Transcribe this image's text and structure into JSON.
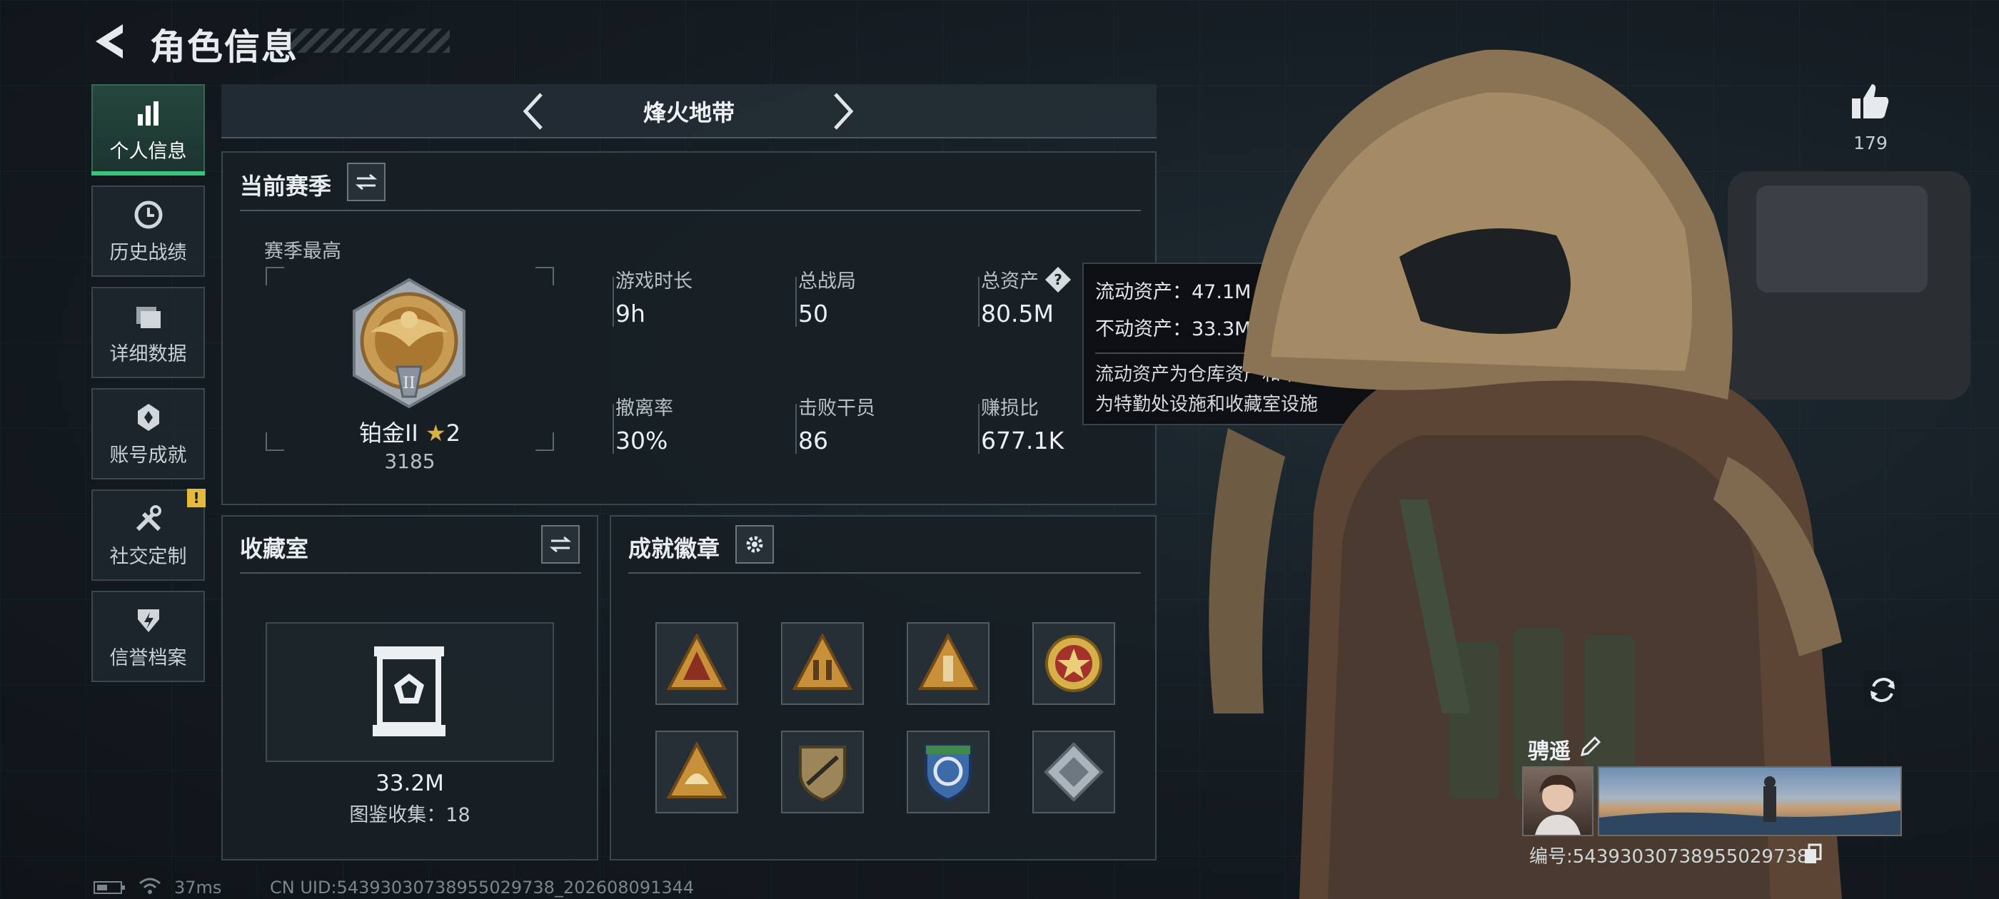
{
  "header": {
    "title": "角色信息"
  },
  "sidebar": {
    "items": [
      {
        "label": "个人信息",
        "icon": "bar-chart-icon",
        "active": true
      },
      {
        "label": "历史战绩",
        "icon": "history-clock-icon"
      },
      {
        "label": "详细数据",
        "icon": "folder-icon"
      },
      {
        "label": "账号成就",
        "icon": "achievement-icon"
      },
      {
        "label": "社交定制",
        "icon": "tools-icon",
        "badge": "!"
      },
      {
        "label": "信誉档案",
        "icon": "credit-shield-icon"
      }
    ]
  },
  "mode": {
    "title": "烽火地带"
  },
  "season": {
    "title": "当前赛季",
    "best_label": "赛季最高",
    "rank_name": "铂金II",
    "rank_stars": "2",
    "rank_score": "3185",
    "stats": [
      {
        "label": "游戏时长",
        "value": "9h"
      },
      {
        "label": "总战局",
        "value": "50"
      },
      {
        "label": "总资产",
        "value": "80.5M"
      },
      {
        "label": "撤离率",
        "value": "30%"
      },
      {
        "label": "击败干员",
        "value": "86"
      },
      {
        "label": "赚损比",
        "value": "677.1K"
      }
    ]
  },
  "tooltip": {
    "liquid": "流动资产：47.1M",
    "fixed": "不动资产：33.3M",
    "desc_line1": "流动资产为仓库资产和哈夫币，不动资产",
    "desc_line2": "为特勤处设施和收藏室设施"
  },
  "collection": {
    "title": "收藏室",
    "value": "33.2M",
    "catalog": "图鉴收集：18"
  },
  "badges": {
    "title": "成就徽章",
    "items": [
      {
        "icon": "triangle-badge-red-icon",
        "color": "#c9903a"
      },
      {
        "icon": "triangle-badge-soldiers-icon",
        "color": "#c9903a"
      },
      {
        "icon": "triangle-badge-tower-icon",
        "color": "#c9903a"
      },
      {
        "icon": "star-medal-icon",
        "color": "#d8b04a"
      },
      {
        "icon": "triangle-badge-helmet-icon",
        "color": "#c9903a"
      },
      {
        "icon": "shield-rifle-badge-icon",
        "color": "#9c8558"
      },
      {
        "icon": "blue-shield-badge-icon",
        "color": "#3d6aa8"
      },
      {
        "icon": "diamond-badge-icon",
        "color": "#aab4bc"
      }
    ]
  },
  "profile": {
    "likes": "179",
    "nickname": "骋遥",
    "id_line": "编号:5439303073895502973 8",
    "id_text": "编号:54393030738955029738"
  },
  "status": {
    "ping": "37ms",
    "uid": "CN UID:54393030738955029738_202608091344"
  },
  "colors": {
    "accent_green": "#39c47c",
    "warn_yellow": "#e5b93b",
    "gold": "#c9903a"
  }
}
